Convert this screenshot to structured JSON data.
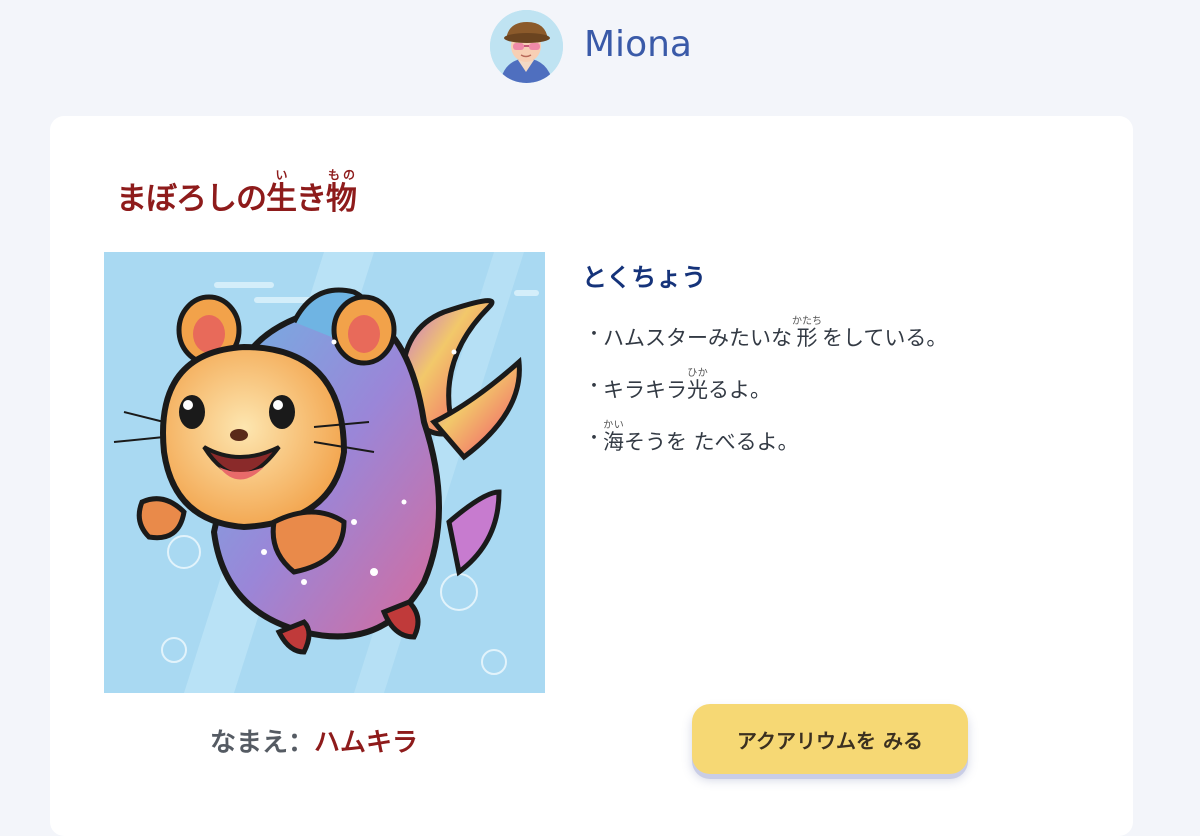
{
  "user": {
    "name": "Miona"
  },
  "card": {
    "title": {
      "base_1": "まぼろしの",
      "kanji_1": "生",
      "ruby_1": "い",
      "base_2": "き",
      "kanji_2": "物",
      "ruby_2": "もの"
    },
    "features_heading": "とくちょう",
    "features": [
      {
        "bullet": "・",
        "pre": "ハムスターみたいな",
        "kanji": "形",
        "ruby": "かたち",
        "post": "をしている。"
      },
      {
        "bullet": "・",
        "pre": "キラキラ",
        "kanji": "光",
        "ruby": "ひか",
        "post": "るよ。"
      },
      {
        "bullet": "・",
        "pre": "",
        "kanji": "海",
        "ruby": "かい",
        "post": "そうを たべるよ。"
      }
    ],
    "name_label": "なまえ：",
    "name_value": "ハムキラ",
    "aquarium_button": "アクアリウムを みる"
  },
  "colors": {
    "background": "#f3f5fa",
    "title": "#8e1b1b",
    "heading": "#15337a",
    "button": "#f6d874"
  },
  "icons": {
    "avatar": "user-avatar-icon",
    "creature": "hamkira-creature-illustration"
  }
}
